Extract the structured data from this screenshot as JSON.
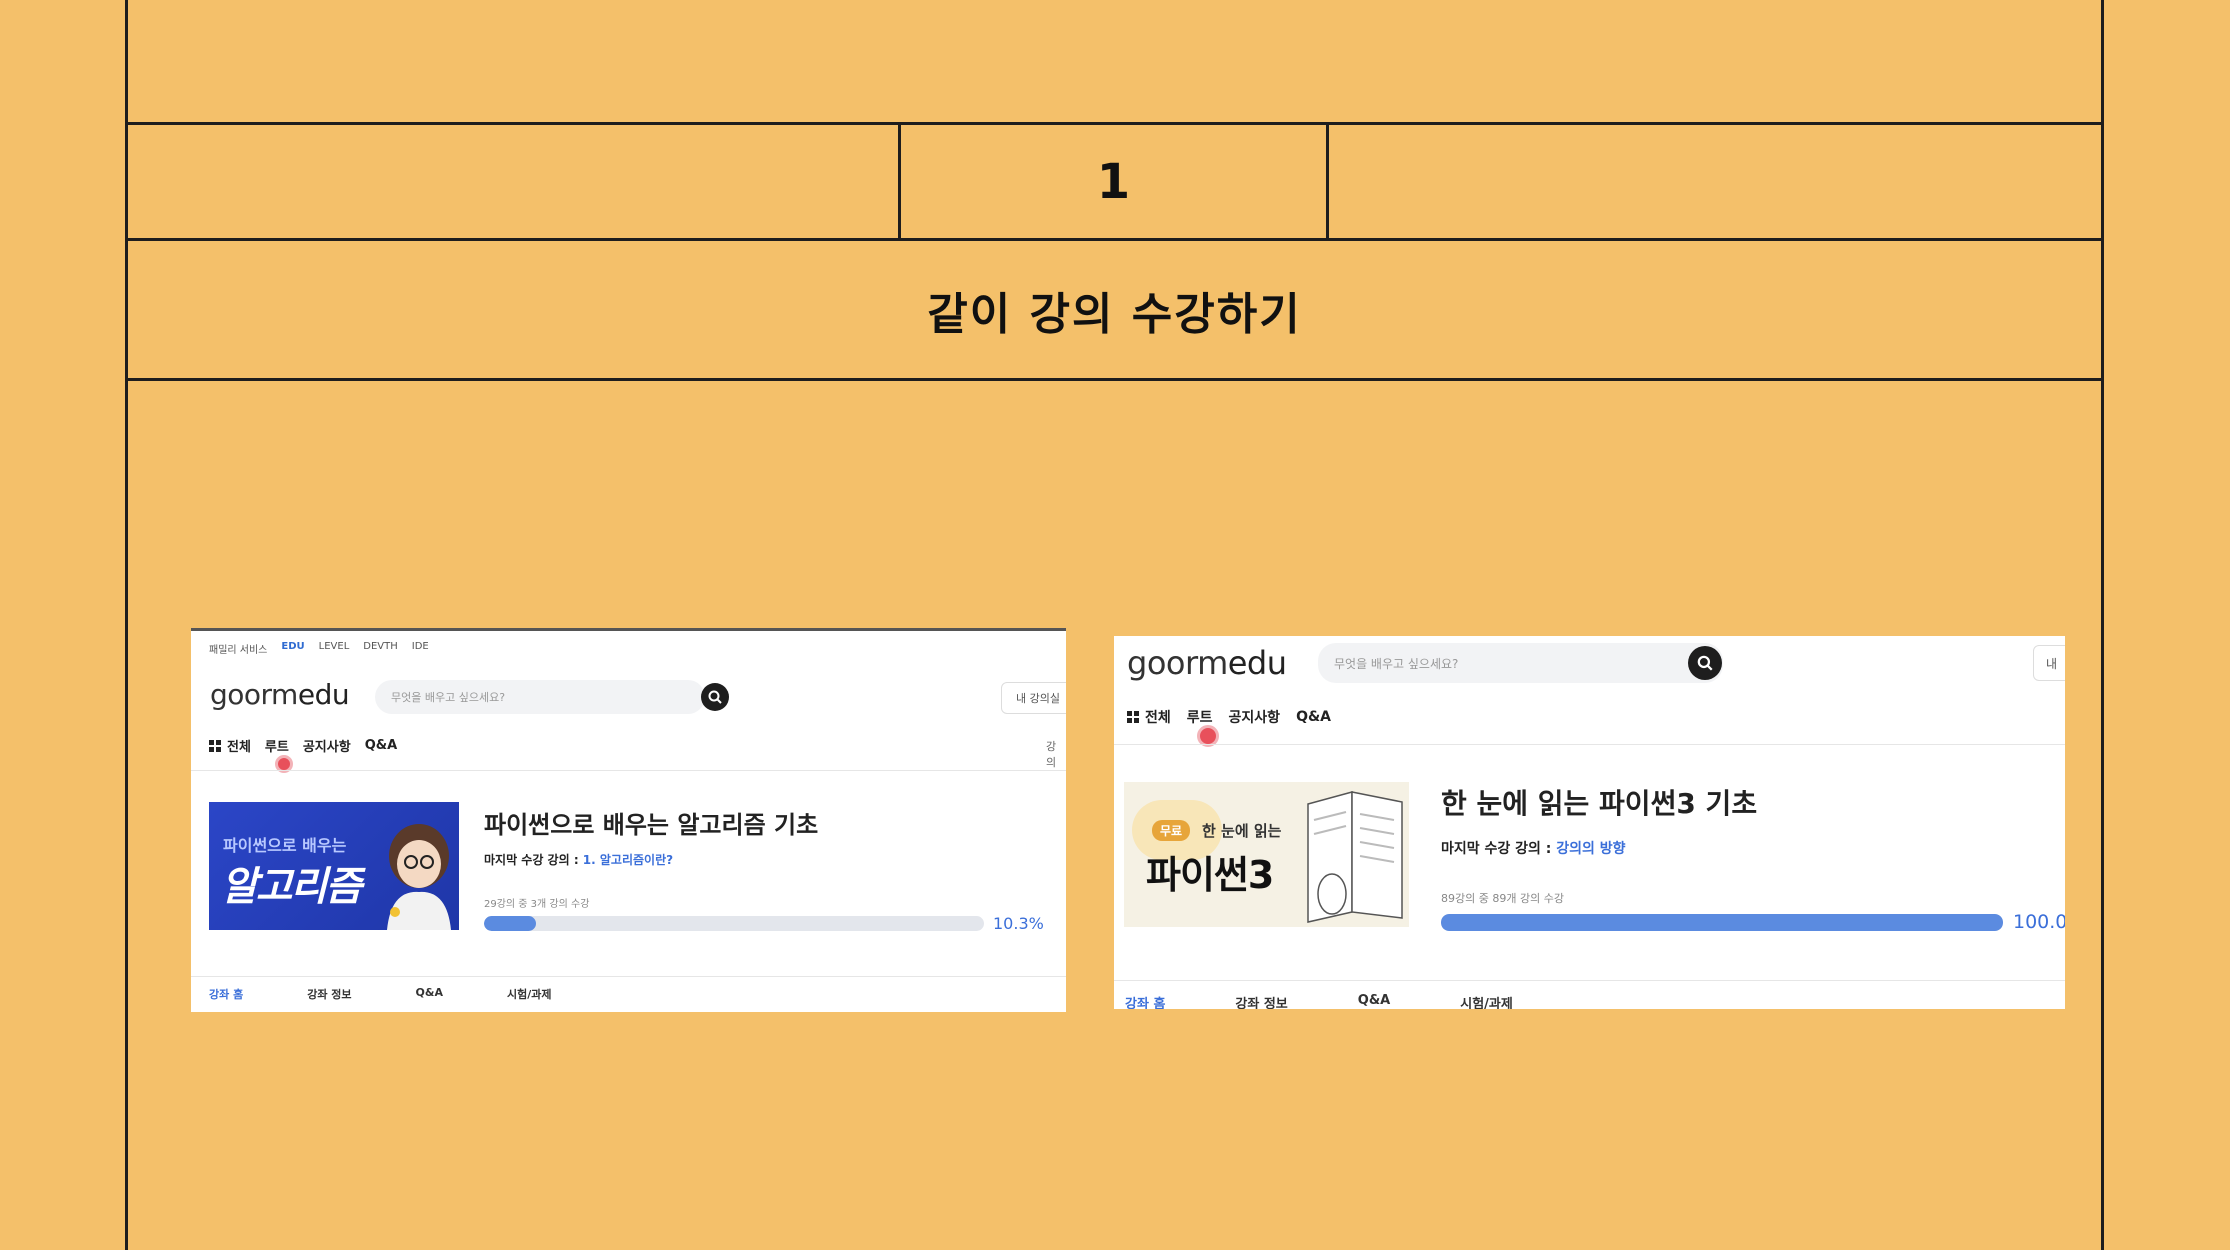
{
  "slide": {
    "number": "1",
    "title": "같이 강의 수강하기"
  },
  "shots": [
    {
      "family_bar": [
        "패밀리 서비스",
        "EDU",
        "LEVEL",
        "DEVTH",
        "IDE"
      ],
      "logo": {
        "prefix": "goorm",
        "suffix": "edu"
      },
      "search": {
        "placeholder": "무엇을 배우고 싶으세요?"
      },
      "my_button": "내 강의실",
      "nav": [
        "전체",
        "루트",
        "공지사항",
        "Q&A"
      ],
      "nav_right": "강의",
      "thumb": {
        "small": "파이썬으로 배우는",
        "big": "알고리즘"
      },
      "course_title": "파이썬으로 배우는 알고리즘 기초",
      "last_label": "마지막 수강 강의 : ",
      "last_link": "1. 알고리즘이란?",
      "progress_caption": "29강의 중 3개 강의 수강",
      "progress": 0.103,
      "progress_text": "10.3%",
      "tabs": [
        "강좌 홈",
        "강좌 정보",
        "Q&A",
        "시험/과제"
      ]
    },
    {
      "logo": {
        "prefix": "goorm",
        "suffix": "edu"
      },
      "search": {
        "placeholder": "무엇을 배우고 싶으세요?"
      },
      "my_button": "내",
      "nav": [
        "전체",
        "루트",
        "공지사항",
        "Q&A"
      ],
      "thumb": {
        "badge": "무료",
        "small": "한 눈에 읽는",
        "big": "파이썬3"
      },
      "course_title": "한 눈에 읽는 파이썬3 기초",
      "last_label": "마지막 수강 강의 : ",
      "last_link": "강의의 방향",
      "progress_caption": "89강의 중 89개 강의 수강",
      "progress": 1.0,
      "progress_text": "100.0",
      "tabs": [
        "강좌 홈",
        "강좌 정보",
        "Q&A",
        "시험/과제"
      ]
    }
  ]
}
